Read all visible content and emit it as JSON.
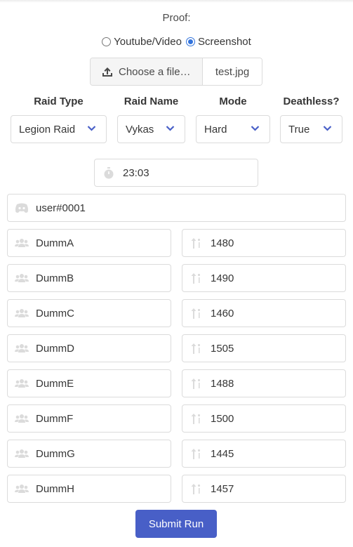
{
  "proof": {
    "label": "Proof:",
    "options": [
      "Youtube/Video",
      "Screenshot"
    ],
    "selected": "Screenshot"
  },
  "file": {
    "button_label": "Choose a file…",
    "file_name": "test.jpg"
  },
  "columns": {
    "raid_type": {
      "label": "Raid Type",
      "value": "Legion Raid"
    },
    "raid_name": {
      "label": "Raid Name",
      "value": "Vykas"
    },
    "mode": {
      "label": "Mode",
      "value": "Hard"
    },
    "deathless": {
      "label": "Deathless?",
      "value": "True"
    }
  },
  "time": "23:03",
  "discord": "user#0001",
  "players": [
    {
      "name": "DummA",
      "ilvl": "1480"
    },
    {
      "name": "DummB",
      "ilvl": "1490"
    },
    {
      "name": "DummC",
      "ilvl": "1460"
    },
    {
      "name": "DummD",
      "ilvl": "1505"
    },
    {
      "name": "DummE",
      "ilvl": "1488"
    },
    {
      "name": "DummF",
      "ilvl": "1500"
    },
    {
      "name": "DummG",
      "ilvl": "1445"
    },
    {
      "name": "DummH",
      "ilvl": "1457"
    }
  ],
  "submit_label": "Submit Run",
  "colors": {
    "accent": "#485fc7",
    "radio": "#3273dc",
    "chevron": "#485fc7",
    "icon": "#dbdbdb"
  }
}
